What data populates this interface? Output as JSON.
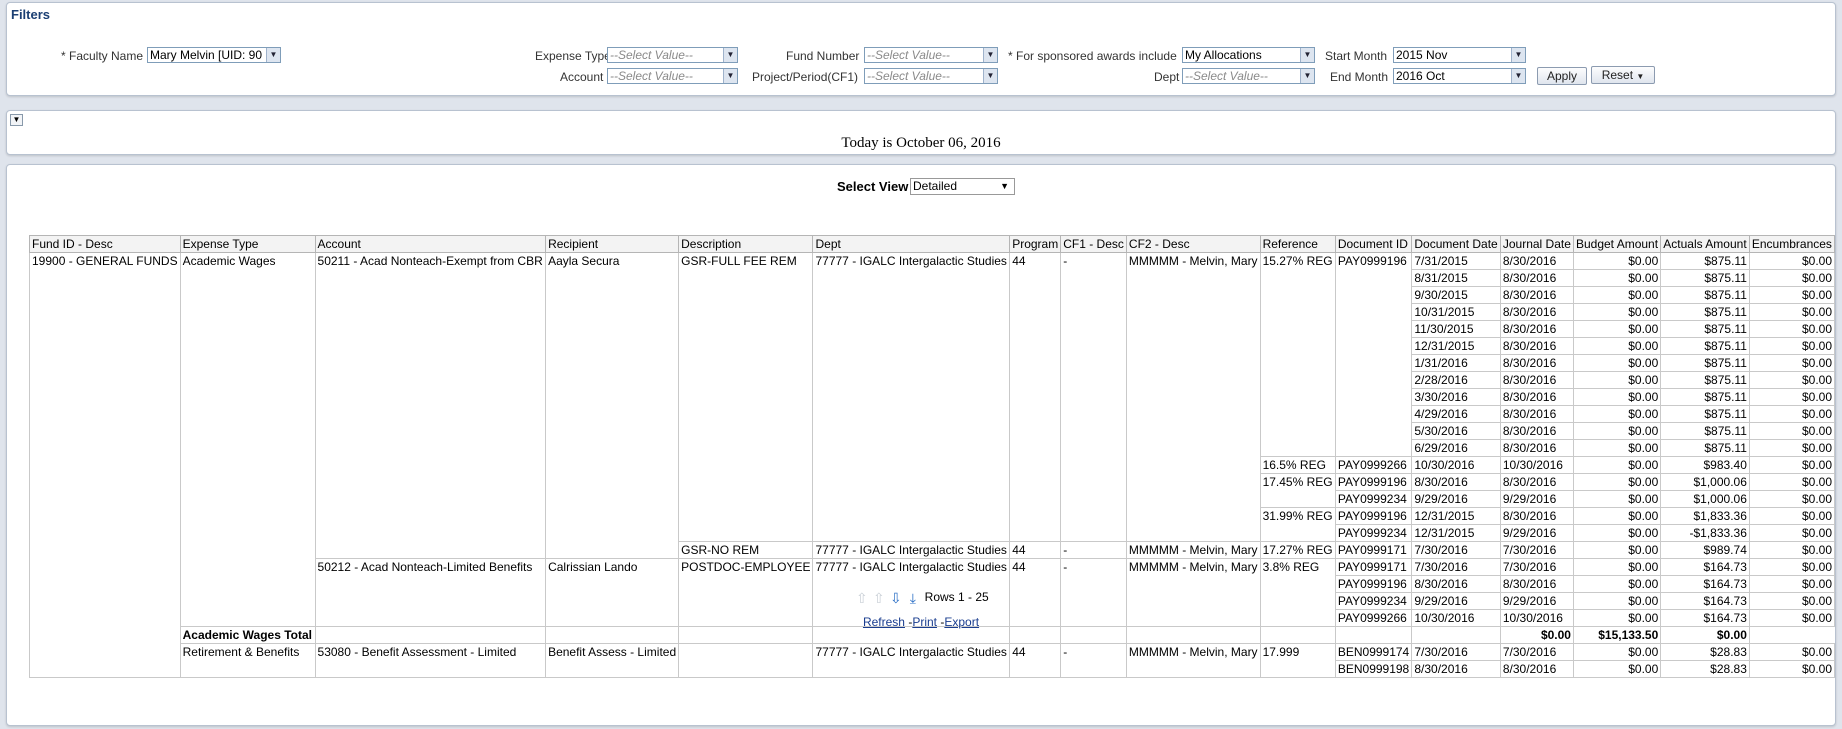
{
  "filters": {
    "title": "Filters",
    "faculty_label": "* Faculty Name",
    "faculty_value": "Mary Melvin [UID: 90",
    "expense_type_label": "Expense Type",
    "account_label": "Account",
    "fund_number_label": "Fund Number",
    "project_label": "Project/Period(CF1)",
    "sponsored_label": "* For sponsored awards include",
    "sponsored_value": "My Allocations",
    "dept_label": "Dept",
    "start_month_label": "Start Month",
    "start_month_value": "2015 Nov",
    "end_month_label": "End Month",
    "end_month_value": "2016 Oct",
    "placeholder": "--Select Value--",
    "apply_label": "Apply",
    "reset_label": "Reset"
  },
  "today_text": "Today is October 06, 2016",
  "view": {
    "label": "Select View",
    "value": "Detailed"
  },
  "table": {
    "headers": [
      "Fund ID - Desc",
      "Expense Type",
      "Account",
      "Recipient",
      "Description",
      "Dept",
      "Program",
      "CF1 - Desc",
      "CF2 - Desc",
      "Reference",
      "Document ID",
      "Document Date",
      "Journal Date",
      "Budget Amount",
      "Actuals Amount",
      "Encumbrances"
    ],
    "fund": "19900 - GENERAL FUNDS",
    "exp_academic": "Academic Wages",
    "exp_retirement": "Retirement & Benefits",
    "acct_50211": "50211 - Acad Nonteach-Exempt from CBR",
    "acct_50212": "50212 - Acad Nonteach-Limited Benefits",
    "acct_53080": "53080 - Benefit Assessment - Limited",
    "recip_aayla": "Aayla Secura",
    "recip_lando": "Calrissian Lando",
    "recip_benefit": "Benefit Assess - Limited",
    "desc_gsr_full": "GSR-FULL FEE REM",
    "desc_gsr_no": "GSR-NO REM",
    "desc_postdoc": "POSTDOC-EMPLOYEE",
    "dept": "77777 - IGALC Intergalactic Studies",
    "program": "44",
    "cf1": "-",
    "cf2": "MMMMM - Melvin, Mary",
    "ref_1527": "15.27% REG",
    "ref_165": "16.5% REG",
    "ref_1745": "17.45% REG",
    "ref_3199": "31.99% REG",
    "ref_1727": "17.27% REG",
    "ref_38": "3.8% REG",
    "ref_17999": "17.999",
    "doc_196": "PAY0999196",
    "doc_266": "PAY0999266",
    "doc_234": "PAY0999234",
    "doc_171": "PAY0999171",
    "detail_rows": [
      {
        "doc_date": "7/31/2015",
        "jrnl": "8/30/2016",
        "budget": "$0.00",
        "actual": "$875.11",
        "enc": "$0.00"
      },
      {
        "doc_date": "8/31/2015",
        "jrnl": "8/30/2016",
        "budget": "$0.00",
        "actual": "$875.11",
        "enc": "$0.00"
      },
      {
        "doc_date": "9/30/2015",
        "jrnl": "8/30/2016",
        "budget": "$0.00",
        "actual": "$875.11",
        "enc": "$0.00"
      },
      {
        "doc_date": "10/31/2015",
        "jrnl": "8/30/2016",
        "budget": "$0.00",
        "actual": "$875.11",
        "enc": "$0.00"
      },
      {
        "doc_date": "11/30/2015",
        "jrnl": "8/30/2016",
        "budget": "$0.00",
        "actual": "$875.11",
        "enc": "$0.00"
      },
      {
        "doc_date": "12/31/2015",
        "jrnl": "8/30/2016",
        "budget": "$0.00",
        "actual": "$875.11",
        "enc": "$0.00"
      },
      {
        "doc_date": "1/31/2016",
        "jrnl": "8/30/2016",
        "budget": "$0.00",
        "actual": "$875.11",
        "enc": "$0.00"
      },
      {
        "doc_date": "2/28/2016",
        "jrnl": "8/30/2016",
        "budget": "$0.00",
        "actual": "$875.11",
        "enc": "$0.00"
      },
      {
        "doc_date": "3/30/2016",
        "jrnl": "8/30/2016",
        "budget": "$0.00",
        "actual": "$875.11",
        "enc": "$0.00"
      },
      {
        "doc_date": "4/29/2016",
        "jrnl": "8/30/2016",
        "budget": "$0.00",
        "actual": "$875.11",
        "enc": "$0.00"
      },
      {
        "doc_date": "5/30/2016",
        "jrnl": "8/30/2016",
        "budget": "$0.00",
        "actual": "$875.11",
        "enc": "$0.00"
      },
      {
        "doc_date": "6/29/2016",
        "jrnl": "8/30/2016",
        "budget": "$0.00",
        "actual": "$875.11",
        "enc": "$0.00"
      },
      {
        "doc_date": "10/30/2016",
        "jrnl": "10/30/2016",
        "budget": "$0.00",
        "actual": "$983.40",
        "enc": "$0.00"
      },
      {
        "doc_date": "8/30/2016",
        "jrnl": "8/30/2016",
        "budget": "$0.00",
        "actual": "$1,000.06",
        "enc": "$0.00"
      },
      {
        "doc_date": "9/29/2016",
        "jrnl": "9/29/2016",
        "budget": "$0.00",
        "actual": "$1,000.06",
        "enc": "$0.00"
      },
      {
        "doc_date": "12/31/2015",
        "jrnl": "8/30/2016",
        "budget": "$0.00",
        "actual": "$1,833.36",
        "enc": "$0.00"
      },
      {
        "doc_date": "12/31/2015",
        "jrnl": "9/29/2016",
        "budget": "$0.00",
        "actual": "-$1,833.36",
        "enc": "$0.00"
      },
      {
        "doc_date": "7/30/2016",
        "jrnl": "7/30/2016",
        "budget": "$0.00",
        "actual": "$989.74",
        "enc": "$0.00"
      },
      {
        "doc_date": "7/30/2016",
        "jrnl": "7/30/2016",
        "budget": "$0.00",
        "actual": "$164.73",
        "enc": "$0.00"
      },
      {
        "doc_date": "8/30/2016",
        "jrnl": "8/30/2016",
        "budget": "$0.00",
        "actual": "$164.73",
        "enc": "$0.00"
      },
      {
        "doc_date": "9/29/2016",
        "jrnl": "9/29/2016",
        "budget": "$0.00",
        "actual": "$164.73",
        "enc": "$0.00"
      },
      {
        "doc_date": "10/30/2016",
        "jrnl": "10/30/2016",
        "budget": "$0.00",
        "actual": "$164.73",
        "enc": "$0.00"
      }
    ],
    "total": {
      "label": "Academic Wages Total",
      "budget": "$0.00",
      "actual": "$15,133.50",
      "enc": "$0.00"
    },
    "ben_rows": [
      {
        "doc": "BEN0999174",
        "doc_date": "7/30/2016",
        "jrnl": "7/30/2016",
        "budget": "$0.00",
        "actual": "$28.83",
        "enc": "$0.00"
      },
      {
        "doc": "BEN0999198",
        "doc_date": "8/30/2016",
        "jrnl": "8/30/2016",
        "budget": "$0.00",
        "actual": "$28.83",
        "enc": "$0.00"
      }
    ]
  },
  "pager": {
    "rows_text": "Rows 1 - 25"
  },
  "links": {
    "refresh": "Refresh",
    "print": "Print",
    "export": "Export"
  }
}
